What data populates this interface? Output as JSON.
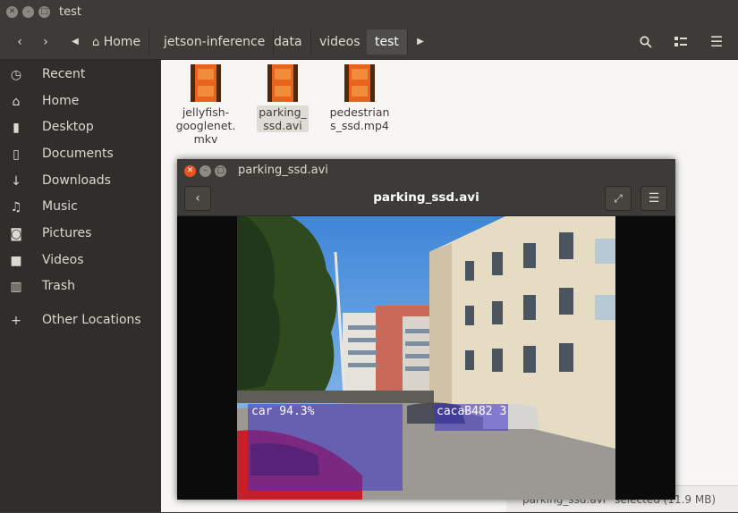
{
  "window": {
    "title": "test"
  },
  "toolbar": {
    "home_label": "Home",
    "breadcrumbs": [
      "jetson-inference",
      "data",
      "videos",
      "test"
    ]
  },
  "sidebar": {
    "items": [
      {
        "label": "Recent",
        "icon": "clock-icon"
      },
      {
        "label": "Home",
        "icon": "home-icon"
      },
      {
        "label": "Desktop",
        "icon": "desktop-icon"
      },
      {
        "label": "Documents",
        "icon": "document-icon"
      },
      {
        "label": "Downloads",
        "icon": "download-icon"
      },
      {
        "label": "Music",
        "icon": "music-icon"
      },
      {
        "label": "Pictures",
        "icon": "camera-icon"
      },
      {
        "label": "Videos",
        "icon": "video-icon"
      },
      {
        "label": "Trash",
        "icon": "trash-icon"
      },
      {
        "label": "Other Locations",
        "icon": "plus-icon"
      }
    ]
  },
  "files": [
    {
      "line1": "jellyfish-",
      "line2": "googlenet.",
      "line3": "mkv",
      "selected": false
    },
    {
      "line1": "parking_",
      "line2": "ssd.avi",
      "line3": "",
      "selected": true
    },
    {
      "line1": "pedestrian",
      "line2": "s_ssd.mp4",
      "line3": "",
      "selected": false
    }
  ],
  "status": {
    "text": "parking_ssd.avi” selected (11.9 MB)"
  },
  "player": {
    "window_title": "parking_ssd.avi",
    "header_title": "parking_ssd.avi",
    "detections": [
      {
        "label": "car 94.3%"
      },
      {
        "label": "cacaB482 3"
      }
    ]
  },
  "colors": {
    "close": "#e95420",
    "detection_box": "#3c32c8",
    "file_icon": "#e8641e"
  }
}
